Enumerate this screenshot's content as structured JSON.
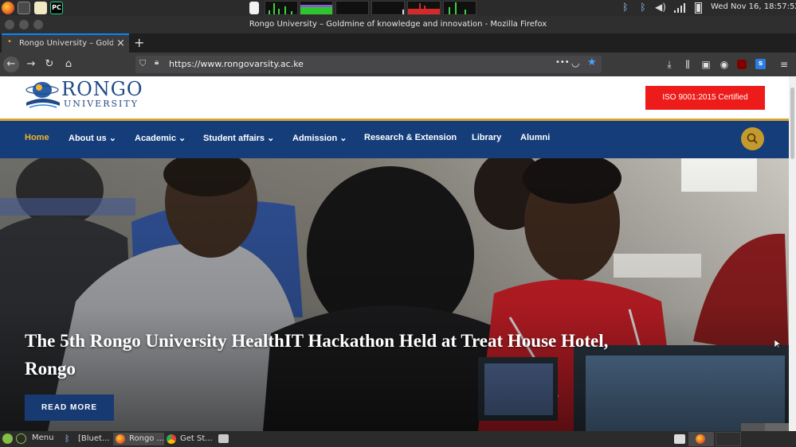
{
  "system_panel": {
    "clock": "Wed Nov 16, 18:57:52",
    "tray_icons": [
      "bluetooth-icon",
      "bluetooth-icon",
      "volume-icon",
      "signal-icon",
      "battery-icon"
    ],
    "launchers": [
      "firefox-icon",
      "terminal-icon",
      "text-editor-icon",
      "pycharm-icon",
      "document-icon"
    ],
    "pycharm_label": "PC"
  },
  "window": {
    "title": "Rongo University – Goldmine of knowledge and innovation - Mozilla Firefox"
  },
  "browser": {
    "tab_title": "Rongo University – Gold",
    "tab_close": "×",
    "new_tab": "+",
    "url": "https://www.rongovarsity.ac.ke",
    "page_actions": "•••",
    "toolbar_icons": [
      "download-icon",
      "library-icon",
      "sidebar-icon",
      "account-icon",
      "ublock-icon",
      "extension-s-icon",
      "menu-icon"
    ]
  },
  "site": {
    "logo_line1": "RONGO",
    "logo_line2": "UNIVERSITY",
    "iso_badge": "ISO 9001:2015 Certified",
    "nav": [
      {
        "label": "Home",
        "active": true
      },
      {
        "label": "About us ⌄",
        "active": false
      },
      {
        "label": "Academic ⌄",
        "active": false
      },
      {
        "label": "Student affairs ⌄",
        "active": false
      },
      {
        "label": "Admission ⌄",
        "active": false
      },
      {
        "label": "Research & Extension",
        "active": false
      },
      {
        "label": "Library",
        "active": false
      },
      {
        "label": "Alumni",
        "active": false
      }
    ],
    "hero_title": "The 5th Rongo University HealthIT Hackathon Held at Treat House Hotel, Rongo",
    "read_more": "READ MORE",
    "colors": {
      "nav_bg": "#143d7a",
      "accent_gold": "#d6a534",
      "iso_red": "#ee1b1b",
      "button_bg": "#173a73"
    }
  },
  "taskbar": {
    "menu_label": "Menu",
    "tasks": [
      {
        "label": "[Bluet...",
        "icon": "bluetooth-icon"
      },
      {
        "label": "Rongo ...",
        "icon": "firefox-icon"
      },
      {
        "label": "Get St...",
        "icon": "chrome-icon"
      }
    ]
  }
}
